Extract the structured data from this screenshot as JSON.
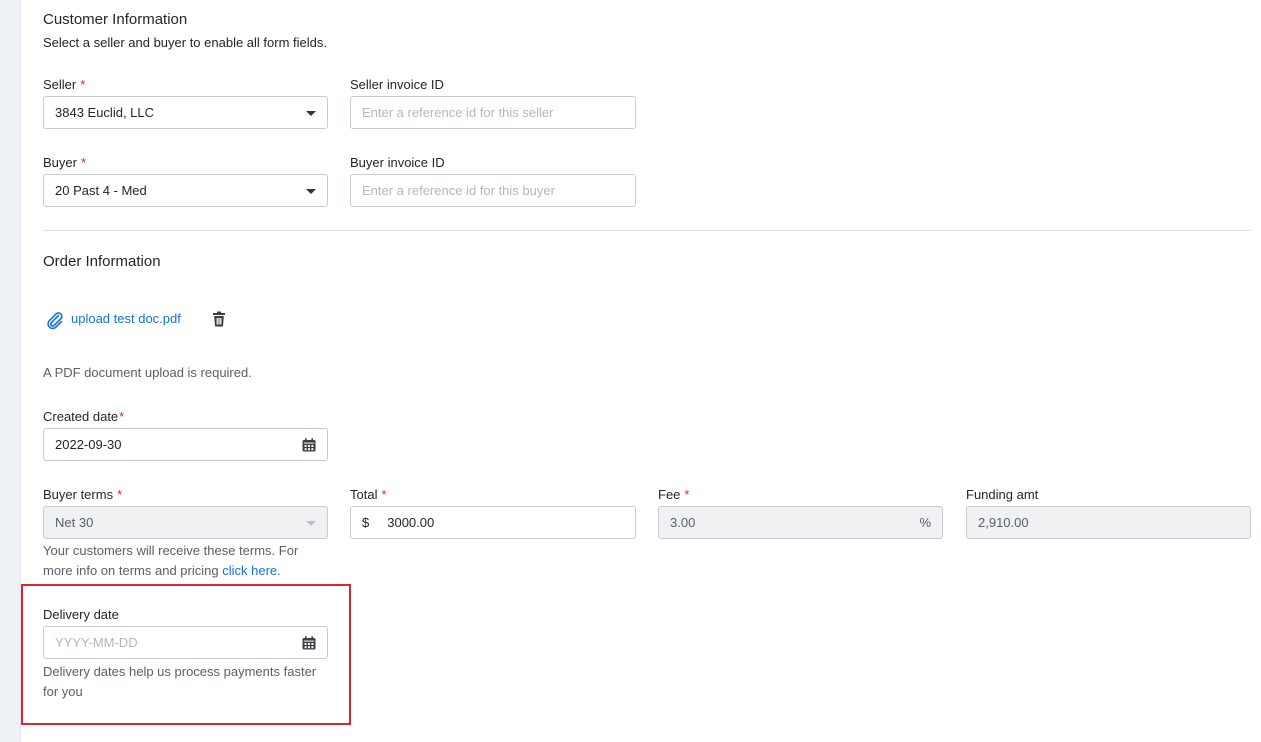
{
  "customer": {
    "title": "Customer Information",
    "subtitle": "Select a seller and buyer to enable all form fields.",
    "seller_label": "Seller",
    "seller_value": "3843 Euclid, LLC",
    "seller_invoice_label": "Seller invoice ID",
    "seller_invoice_placeholder": "Enter a reference id for this seller",
    "buyer_label": "Buyer",
    "buyer_value": "20 Past 4 - Med",
    "buyer_invoice_label": "Buyer invoice ID",
    "buyer_invoice_placeholder": "Enter a reference id for this buyer"
  },
  "order": {
    "title": "Order Information",
    "file_name": "upload test doc.pdf",
    "pdf_note": "A PDF document upload is required.",
    "created_label": "Created date",
    "created_value": "2022-09-30",
    "terms_label": "Buyer terms",
    "terms_value": "Net 30",
    "terms_help_1": "Your customers will receive these terms. For",
    "terms_help_2": "more info on terms and pricing",
    "terms_link": "click here.",
    "total_label": "Total",
    "total_prefix": "$",
    "total_value": "3000.00",
    "fee_label": "Fee",
    "fee_value": "3.00",
    "fee_suffix": "%",
    "funding_label": "Funding amt",
    "funding_value": "2,910.00",
    "delivery_label": "Delivery date",
    "delivery_placeholder": "YYYY-MM-DD",
    "delivery_help_1": "Delivery dates help us process payments faster",
    "delivery_help_2": "for you"
  },
  "required_mark": "*",
  "icons": {
    "attach": "paperclip-icon",
    "delete": "trash-icon",
    "calendar": "calendar-icon"
  },
  "colors": {
    "required": "#d92632",
    "link": "#1573d6",
    "highlight": "#d92632"
  }
}
